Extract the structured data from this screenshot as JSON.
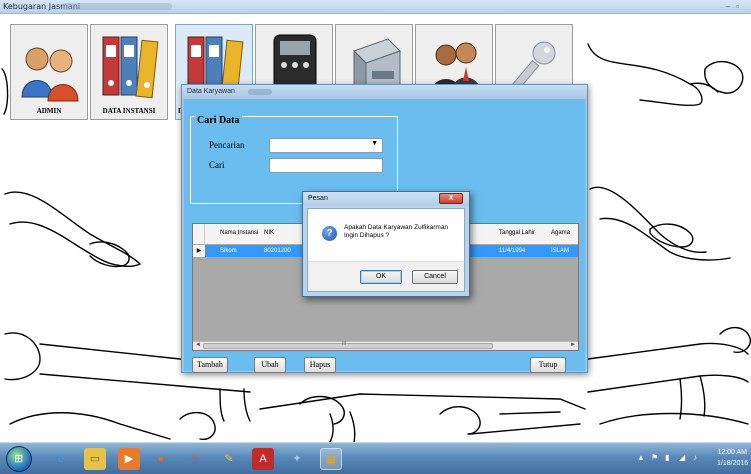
{
  "window": {
    "title": "Kebugaran Jasmani"
  },
  "toolbar": {
    "tiles": [
      {
        "label": "ADMIN"
      },
      {
        "label": "DATA INSTANSI"
      },
      {
        "label": "D"
      },
      {
        "label": ""
      },
      {
        "label": ""
      },
      {
        "label": ""
      },
      {
        "label": ""
      }
    ]
  },
  "dialog": {
    "title": "Data Karyawan",
    "group_title": "Cari Data",
    "pencarian_label": "Pencarian",
    "pencarian_value": "",
    "cari_label": "Cari",
    "cari_value": "",
    "grid": {
      "columns": [
        "Nama Instansi",
        "NIK",
        "Tanggal Lahir",
        "Agama"
      ],
      "rows": [
        {
          "marker": "▶",
          "cells": [
            "Sikom",
            "80201200",
            "11/4/1994",
            "ISLAM"
          ]
        }
      ],
      "scroll_mid": "III",
      "scroll_left": "◄",
      "scroll_right": "►"
    },
    "buttons": {
      "tambah": "Tambah",
      "ubah": "Ubah",
      "hapus": "Hapus",
      "tutup": "Tutup"
    }
  },
  "message_box": {
    "title": "Pesan",
    "close_glyph": "X",
    "icon_glyph": "?",
    "text": "Apakah Data Karyawan Zulfikarman Ingin Dihapus ?",
    "ok_label": "OK",
    "cancel_label": "Cancel"
  },
  "taskbar": {
    "start_glyph": "⊞",
    "clock_time": "12:00 AM",
    "clock_date": "1/18/2016",
    "icons": [
      "ie-icon",
      "explorer-icon",
      "media-player-icon",
      "firefox-icon",
      "java-icon",
      "paint-icon",
      "acrobat-icon",
      "app-icon",
      "app-running-icon"
    ]
  },
  "colors": {
    "dialog_body": "#6bbdf0",
    "grid_selection": "#3399ff",
    "taskbar": "#5a89b8"
  }
}
